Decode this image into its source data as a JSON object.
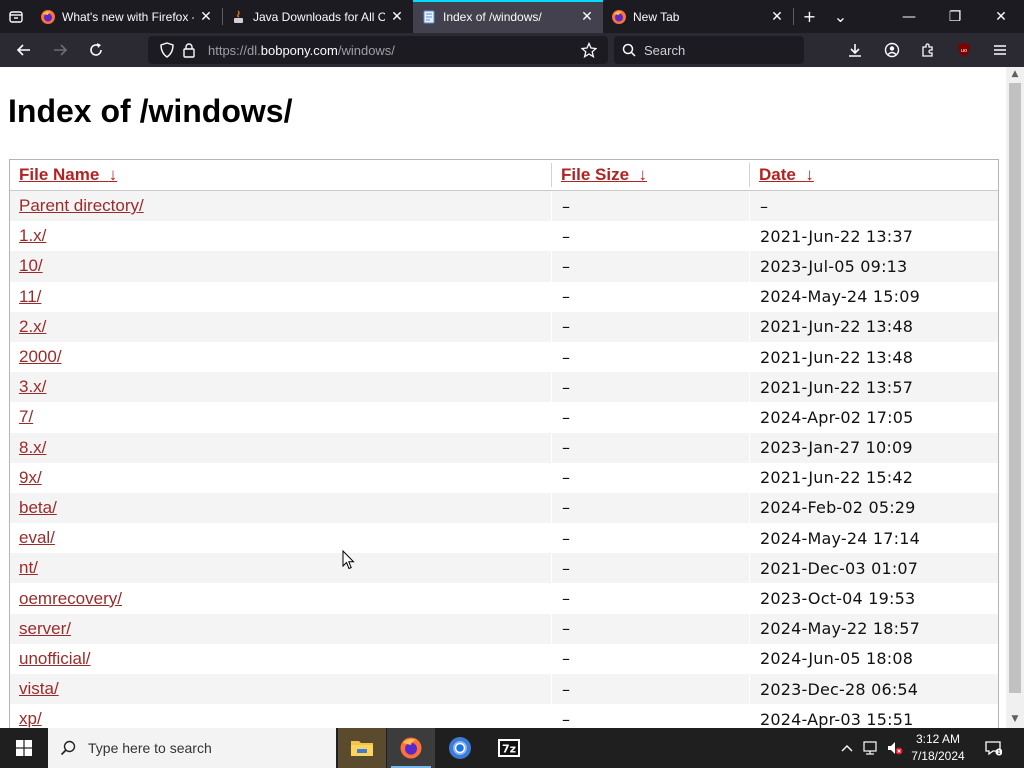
{
  "browser": {
    "tabs": [
      {
        "title": "What's new with Firefox -",
        "favicon": "firefox-icon",
        "active": false
      },
      {
        "title": "Java Downloads for All Op",
        "favicon": "java-icon",
        "active": false
      },
      {
        "title": "Index of /windows/",
        "favicon": "page-icon",
        "active": true
      },
      {
        "title": "New Tab",
        "favicon": "firefox-icon",
        "active": false
      }
    ],
    "url_prefix": "https://dl.",
    "url_domain": "bobpony.com",
    "url_path": "/windows/",
    "search_placeholder": "Search",
    "close_glyph": "✕",
    "new_tab_glyph": "+",
    "all_tabs_glyph": "⌄",
    "min_glyph": "—",
    "max_glyph": "❐",
    "win_close_glyph": "✕"
  },
  "page": {
    "title": "Index of /windows/",
    "headers": {
      "name": "File Name",
      "size": "File Size",
      "date": "Date",
      "sort_arrow": "↓"
    },
    "rows": [
      {
        "name": "Parent directory/",
        "size": "–",
        "date": "–"
      },
      {
        "name": "1.x/",
        "size": "–",
        "date": "2021-Jun-22 13:37"
      },
      {
        "name": "10/",
        "size": "–",
        "date": "2023-Jul-05 09:13"
      },
      {
        "name": "11/",
        "size": "–",
        "date": "2024-May-24 15:09"
      },
      {
        "name": "2.x/",
        "size": "–",
        "date": "2021-Jun-22 13:48"
      },
      {
        "name": "2000/",
        "size": "–",
        "date": "2021-Jun-22 13:48"
      },
      {
        "name": "3.x/",
        "size": "–",
        "date": "2021-Jun-22 13:57"
      },
      {
        "name": "7/",
        "size": "–",
        "date": "2024-Apr-02 17:05"
      },
      {
        "name": "8.x/",
        "size": "–",
        "date": "2023-Jan-27 10:09"
      },
      {
        "name": "9x/",
        "size": "–",
        "date": "2021-Jun-22 15:42"
      },
      {
        "name": "beta/",
        "size": "–",
        "date": "2024-Feb-02 05:29"
      },
      {
        "name": "eval/",
        "size": "–",
        "date": "2024-May-24 17:14"
      },
      {
        "name": "nt/",
        "size": "–",
        "date": "2021-Dec-03 01:07"
      },
      {
        "name": "oemrecovery/",
        "size": "–",
        "date": "2023-Oct-04 19:53"
      },
      {
        "name": "server/",
        "size": "–",
        "date": "2024-May-22 18:57"
      },
      {
        "name": "unofficial/",
        "size": "–",
        "date": "2024-Jun-05 18:08"
      },
      {
        "name": "vista/",
        "size": "–",
        "date": "2023-Dec-28 06:54"
      },
      {
        "name": "xp/",
        "size": "–",
        "date": "2024-Apr-03 15:51"
      }
    ]
  },
  "taskbar": {
    "search_placeholder": "Type here to search",
    "time": "3:12 AM",
    "date": "7/18/2024",
    "apps": [
      "file-explorer-icon",
      "firefox-icon",
      "chrome-icon",
      "7zip-icon"
    ],
    "sevenzip_label": "7z"
  },
  "colors": {
    "link": "#9b2b2b",
    "header_link": "#b22222",
    "tab_accent": "#00ddff",
    "toolbar": "#2b2a33",
    "tabstrip": "#1c1b22"
  }
}
